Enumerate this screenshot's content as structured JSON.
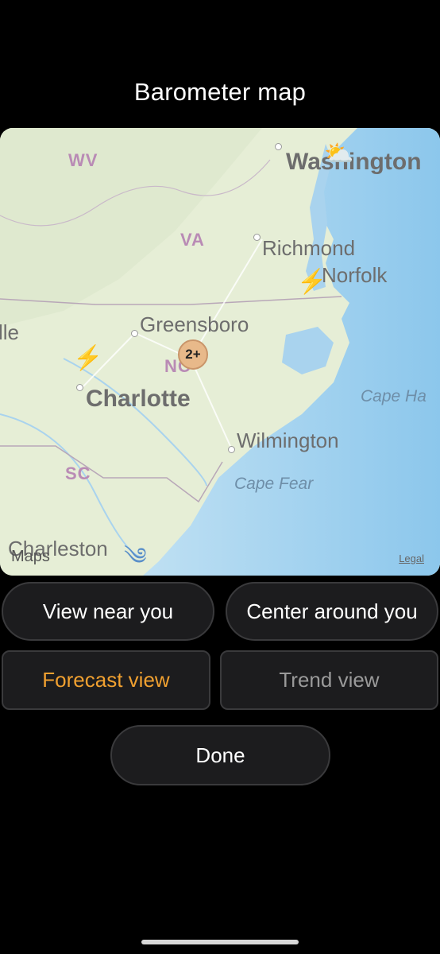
{
  "title": "Barometer map",
  "map": {
    "states": {
      "wv": "WV",
      "va": "VA",
      "nc": "NC",
      "sc": "SC"
    },
    "cities": {
      "washington": "Washington",
      "richmond": "Richmond",
      "norfolk": "Norfolk",
      "greensboro": "Greensboro",
      "charlotte": "Charlotte",
      "wilmington": "Wilmington",
      "charleston": "Charleston",
      "left_partial": "lle"
    },
    "capes": {
      "hatteras": "Cape Ha",
      "fear": "Cape Fear"
    },
    "cluster_count": "2+",
    "weather_icons": {
      "washington": "partly-cloudy-icon",
      "norfolk": "lightning-icon",
      "charlotte": "lightning-icon",
      "charleston": "wind-icon"
    },
    "attribution": "Maps",
    "legal": "Legal"
  },
  "buttons": {
    "view_near": "View near you",
    "center_around": "Center around you",
    "forecast": "Forecast view",
    "trend": "Trend view",
    "done": "Done"
  },
  "colors": {
    "accent": "#f0a030",
    "background": "#000000",
    "button_bg": "#1c1c1e"
  }
}
